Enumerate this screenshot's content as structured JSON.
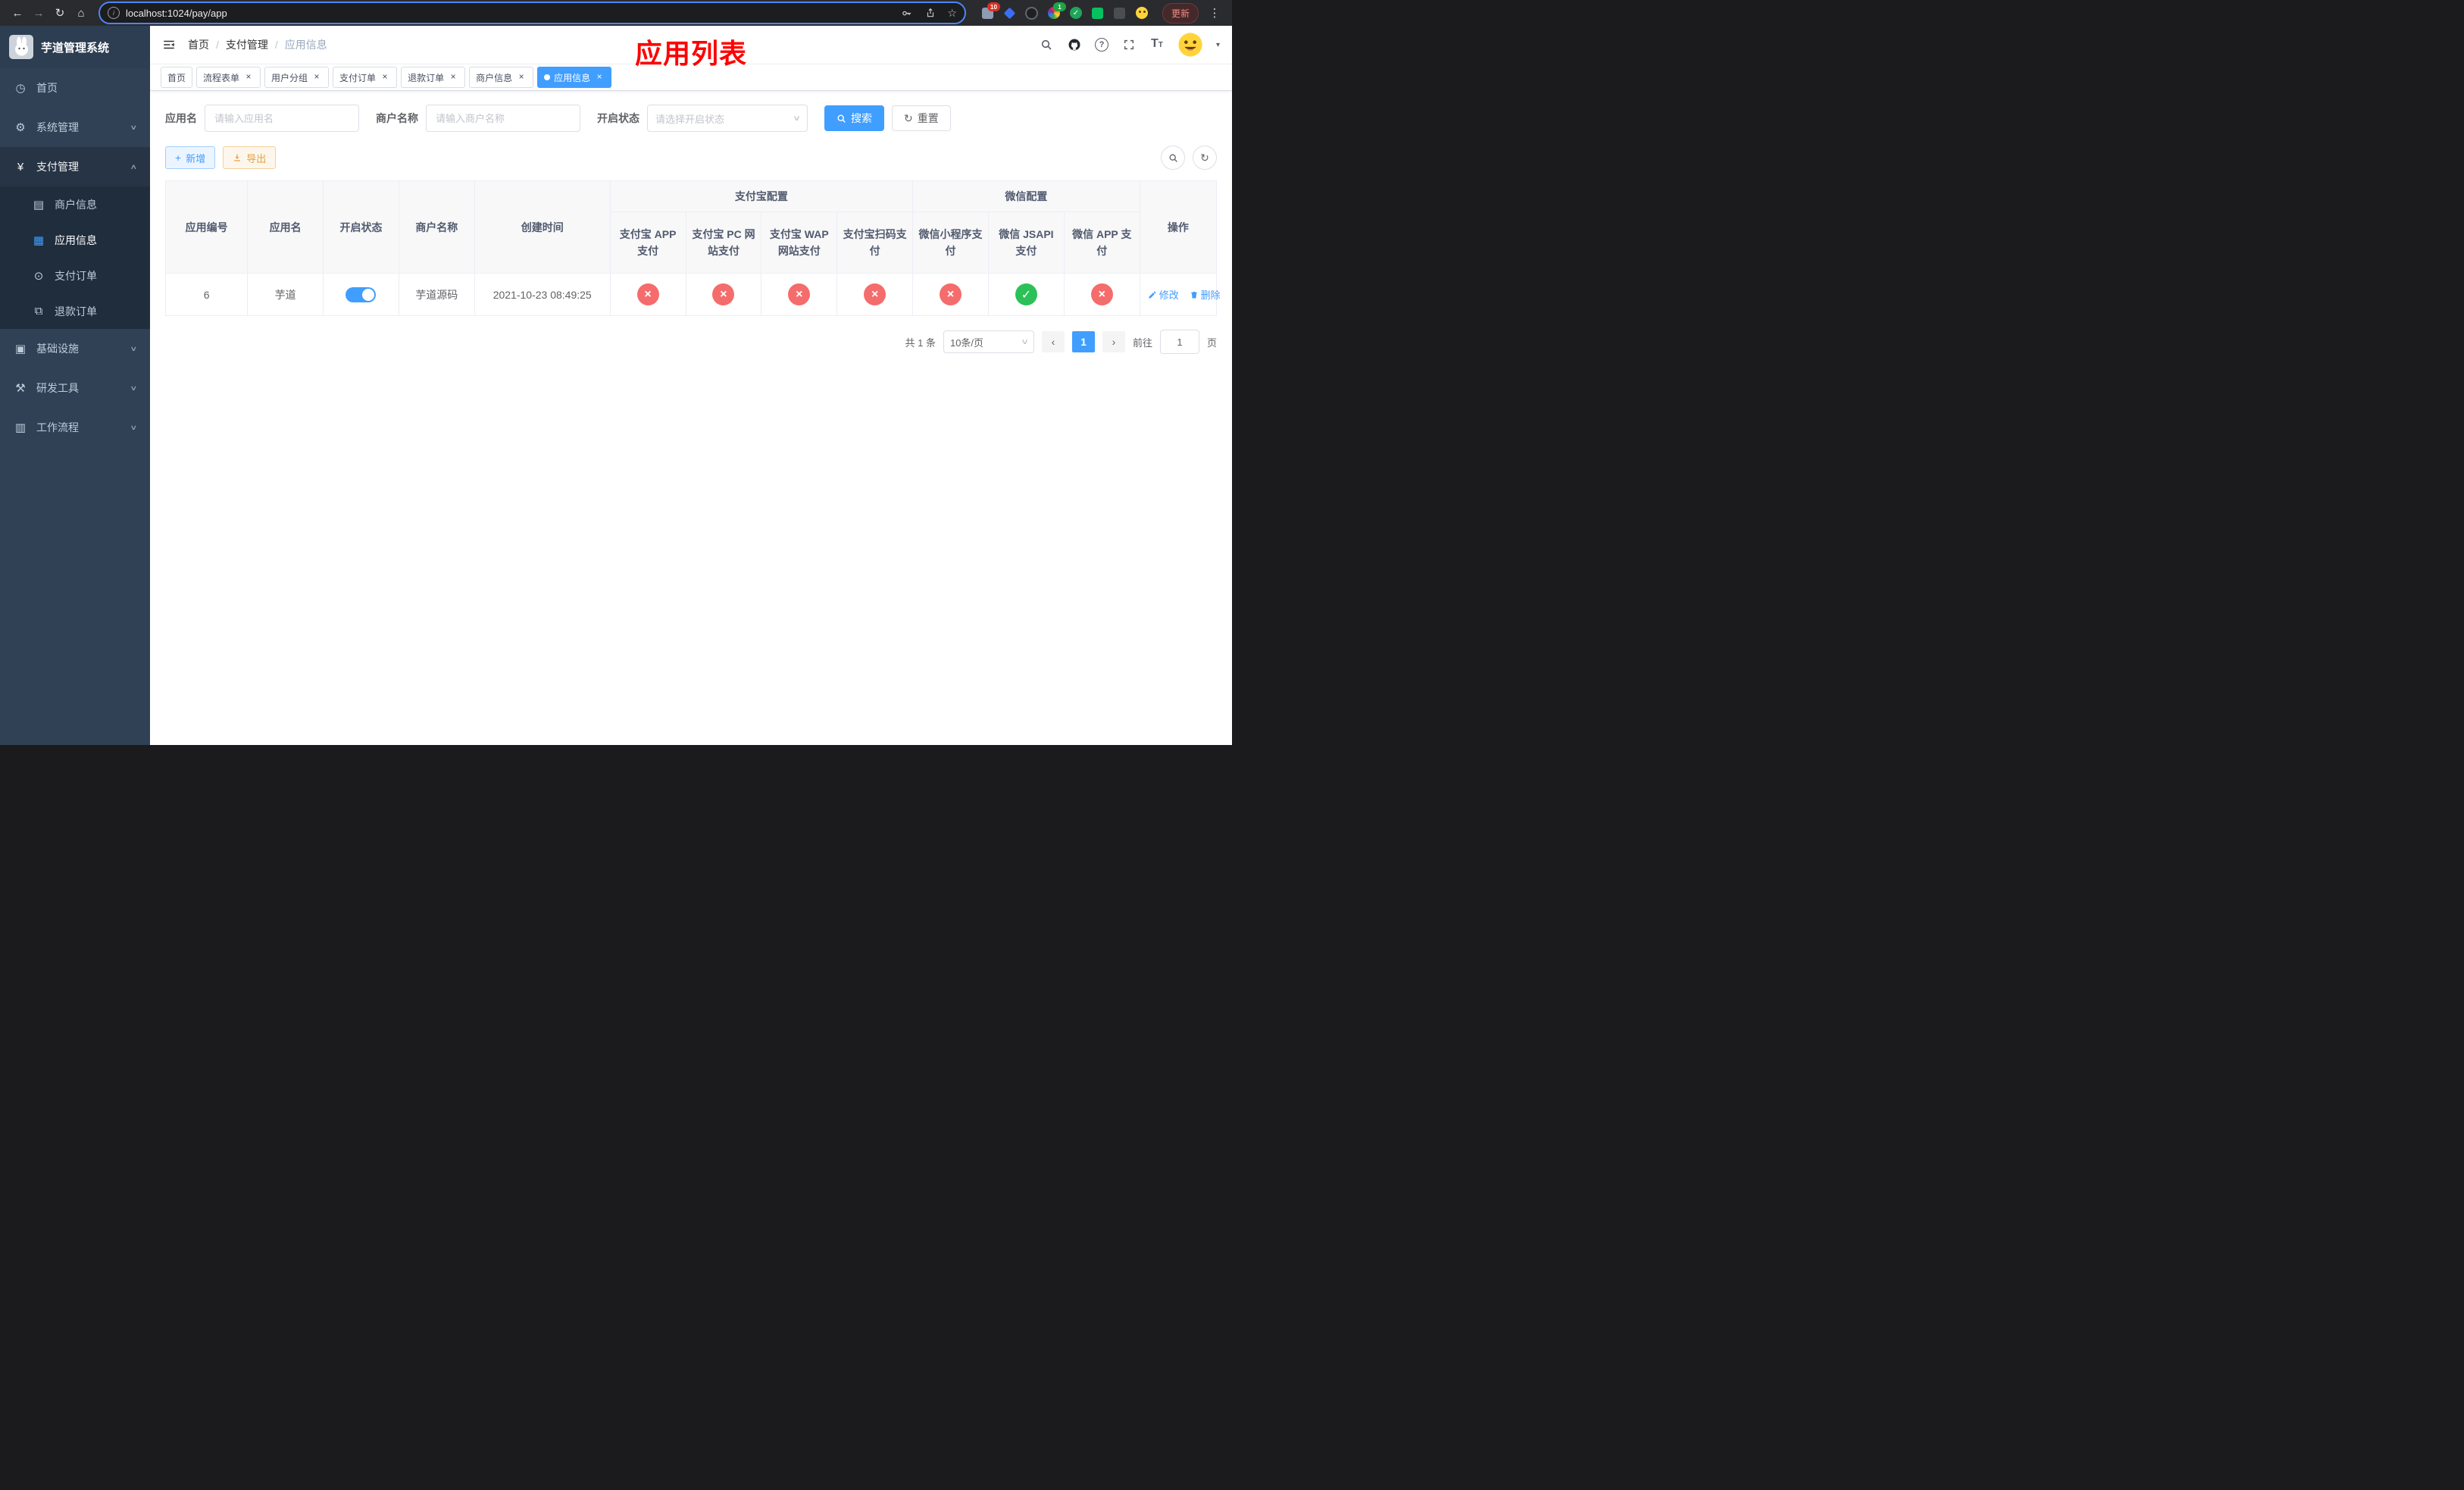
{
  "colors": {
    "primary": "#409eff",
    "danger": "#f56c6c",
    "success": "#2bc158",
    "warning": "#e6a23c",
    "sidebar_bg": "#304156",
    "title_red": "#ff0000"
  },
  "icons": {
    "back": "←",
    "forward": "→",
    "reload": "↻",
    "home": "⌂",
    "star": "☆",
    "menu_dots": "⋮",
    "close": "×",
    "check": "✓",
    "cross": "×",
    "plus": "+",
    "refresh": "↻",
    "prev": "‹",
    "next": "›",
    "caret": "∨",
    "caret_down": "▾",
    "chevron_down": "∨",
    "chevron_up": "∧",
    "dashboard": "◷",
    "gear": "⚙",
    "yen": "¥",
    "card": "▤",
    "grid": "▦",
    "order": "⊙",
    "refund": "⧉",
    "infra": "▣",
    "tools": "⚒",
    "workflow": "▥"
  },
  "browser": {
    "url": "localhost:1024/pay/app",
    "update_label": "更新",
    "ext_badge_red": "10",
    "ext_badge_green": "1"
  },
  "sidebar": {
    "logo_title": "芋道管理系统",
    "items": [
      {
        "label": "首页"
      },
      {
        "label": "系统管理"
      },
      {
        "label": "支付管理"
      },
      {
        "label": "基础设施"
      },
      {
        "label": "研发工具"
      },
      {
        "label": "工作流程"
      }
    ],
    "payment_children": [
      {
        "label": "商户信息"
      },
      {
        "label": "应用信息"
      },
      {
        "label": "支付订单"
      },
      {
        "label": "退款订单"
      }
    ]
  },
  "navbar": {
    "separator": "/",
    "breadcrumb": [
      {
        "label": "首页"
      },
      {
        "label": "支付管理"
      },
      {
        "label": "应用信息"
      }
    ],
    "page_title": "应用列表"
  },
  "tabs": [
    {
      "label": "首页",
      "closable": false,
      "active": false
    },
    {
      "label": "流程表单",
      "closable": true,
      "active": false
    },
    {
      "label": "用户分组",
      "closable": true,
      "active": false
    },
    {
      "label": "支付订单",
      "closable": true,
      "active": false
    },
    {
      "label": "退款订单",
      "closable": true,
      "active": false
    },
    {
      "label": "商户信息",
      "closable": true,
      "active": false
    },
    {
      "label": "应用信息",
      "closable": true,
      "active": true
    }
  ],
  "filters": {
    "app_name_label": "应用名",
    "app_name_placeholder": "请输入应用名",
    "merchant_label": "商户名称",
    "merchant_placeholder": "请输入商户名称",
    "status_label": "开启状态",
    "status_placeholder": "请选择开启状态",
    "search_label": "搜索",
    "reset_label": "重置"
  },
  "toolbar": {
    "add_label": "新增",
    "export_label": "导出"
  },
  "table": {
    "group_alipay": "支付宝配置",
    "group_wechat": "微信配置",
    "col_app_id": "应用编号",
    "col_app_name": "应用名",
    "col_status": "开启状态",
    "col_merchant": "商户名称",
    "col_create_time": "创建时间",
    "col_alipay_app": "支付宝 APP 支付",
    "col_alipay_pc": "支付宝 PC 网站支付",
    "col_alipay_wap": "支付宝 WAP 网站支付",
    "col_alipay_qr": "支付宝扫码支付",
    "col_wx_mini": "微信小程序支付",
    "col_wx_jsapi": "微信 JSAPI 支付",
    "col_wx_app": "微信 APP 支付",
    "col_actions": "操作",
    "rows": [
      {
        "app_id": "6",
        "app_name": "芋道",
        "status_on": true,
        "merchant": "芋道源码",
        "create_time": "2021-10-23 08:49:25",
        "alipay_app": "off",
        "alipay_pc": "off",
        "alipay_wap": "off",
        "alipay_qr": "off",
        "wx_mini": "off",
        "wx_jsapi": "on",
        "wx_app": "off",
        "edit_label": "修改",
        "delete_label": "删除"
      }
    ]
  },
  "pagination": {
    "total_text": "共 1 条",
    "page_size_text": "10条/页",
    "current_page": "1",
    "goto_label": "前往",
    "goto_value": "1",
    "goto_suffix": "页"
  }
}
